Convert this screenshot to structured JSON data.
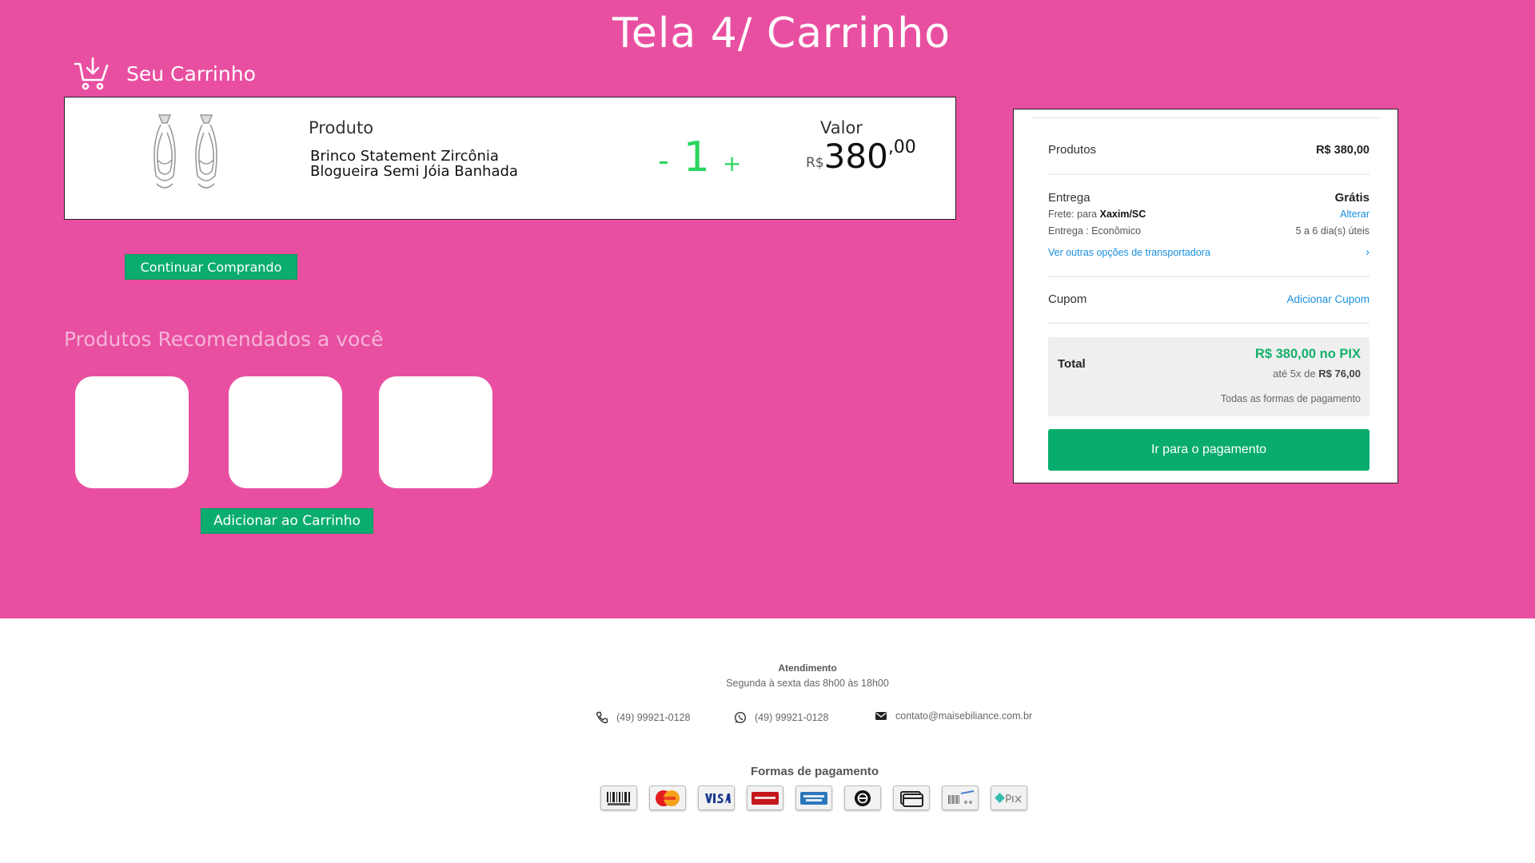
{
  "page": {
    "title": "Tela 4/ Carrinho"
  },
  "cart": {
    "heading": "Seu Carrinho",
    "item": {
      "product_header": "Produto",
      "name": "Brinco Statement Zircônia Blogueira Semi Jóia Banhada",
      "qty_minus": "-",
      "quantity": "1",
      "qty_plus": "+",
      "value_header": "Valor",
      "currency": "R$",
      "price_int": "380",
      "price_cents": ",00"
    },
    "continue_label": "Continuar Comprando"
  },
  "recommended": {
    "title": "Produtos Recomendados a você",
    "add_label": "Adicionar ao Carrinho"
  },
  "summary": {
    "products_label": "Produtos",
    "products_value": "R$ 380,00",
    "delivery_label": "Entrega",
    "delivery_value": "Grátis",
    "freight_prefix": "Frete: para ",
    "freight_city": "Xaxim/SC",
    "change_link": "Alterar",
    "delivery_type": "Entrega : Econômico",
    "delivery_days": "5 a 6 dia(s) úteis",
    "other_carriers": "Ver outras opções de transportadora",
    "chevron": "›",
    "coupon_label": "Cupom",
    "coupon_link": "Adicionar Cupom",
    "total_label": "Total",
    "total_pix": "R$ 380,00 no PIX",
    "installments_prefix": "até 5x de ",
    "installments_value": "R$ 76,00",
    "all_payment": "Todas as formas de pagamento",
    "pay_button": "Ir para o pagamento"
  },
  "footer": {
    "attendance_title": "Atendimento",
    "attendance_hours": "Segunda à sexta das 8h00 às 18h00",
    "phone": "(49) 99921-0128",
    "whatsapp": "(49) 99921-0128",
    "email": "contato@maisebiliance.com.br",
    "payment_title": "Formas de pagamento",
    "payment_methods": [
      "boleto",
      "mastercard",
      "visa",
      "hipercard",
      "amex",
      "elo",
      "card",
      "transfer",
      "pix"
    ]
  },
  "colors": {
    "background": "#e94fa0",
    "accent_green": "#0aad6e",
    "qty_green": "#2bd45e",
    "link_blue": "#1a8fdd"
  }
}
